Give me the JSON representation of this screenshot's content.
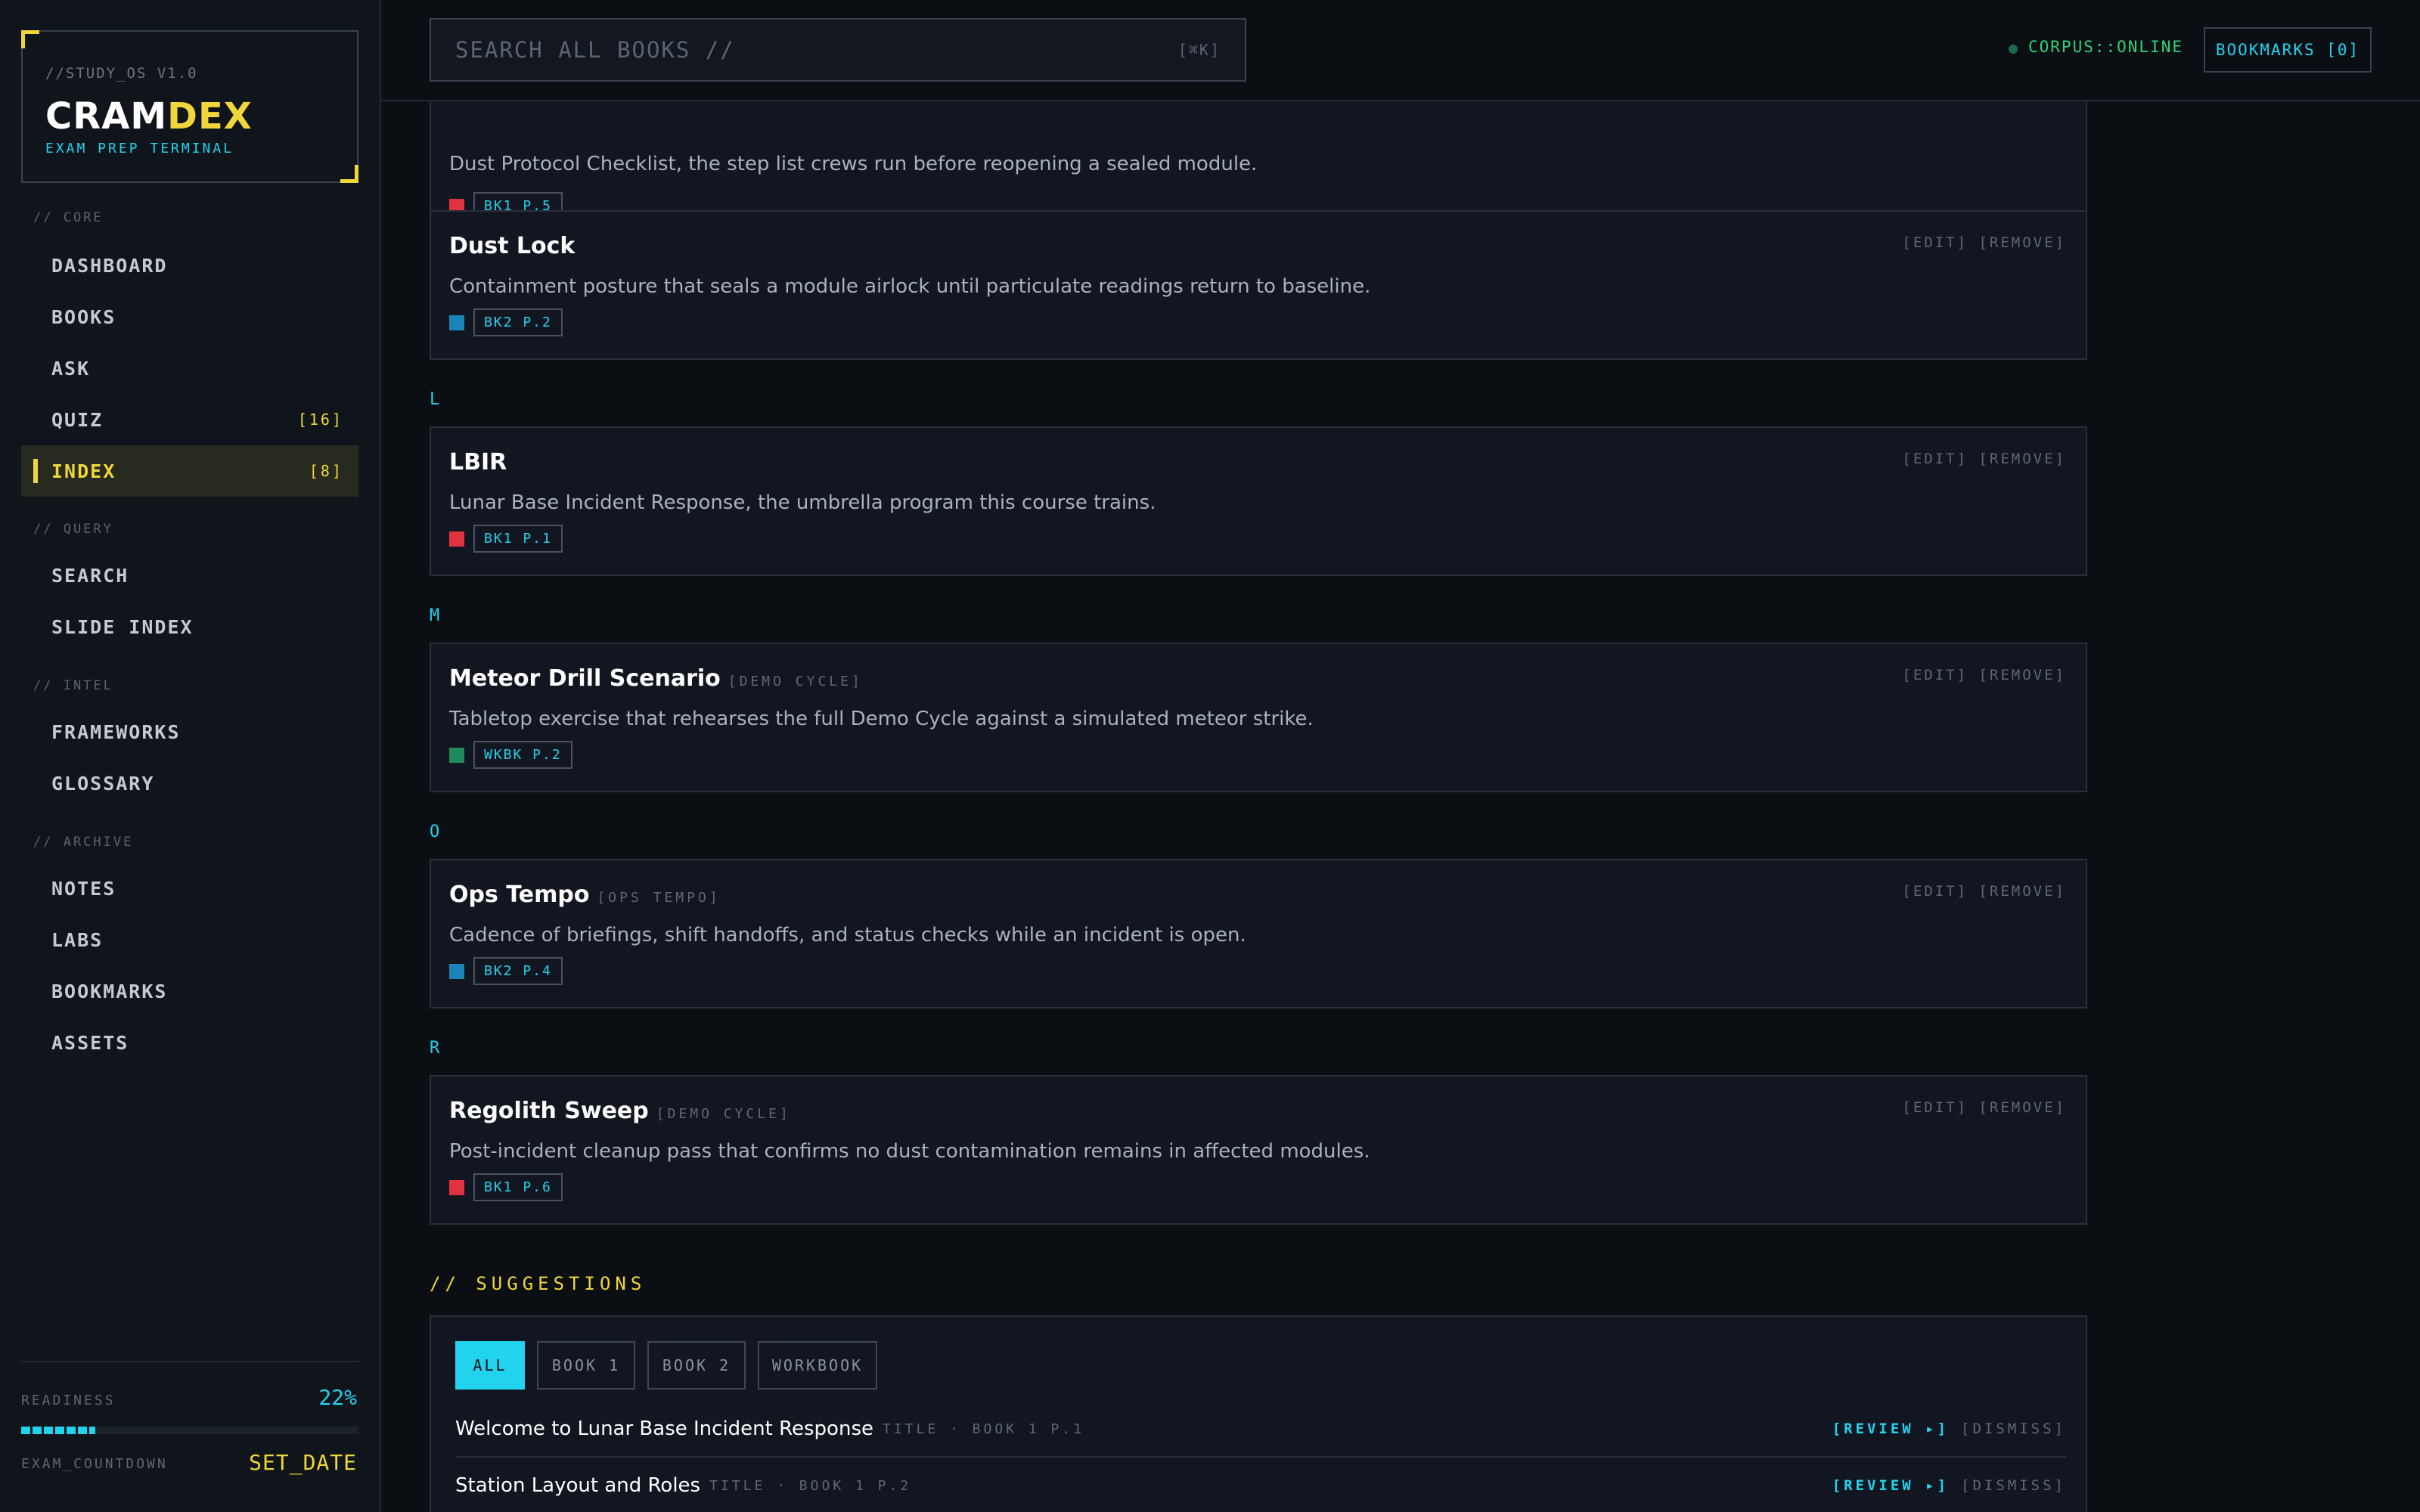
{
  "brand": {
    "version": "//STUDY_OS V1.0",
    "name_a": "CRAM",
    "name_b": "DEX",
    "tagline": "EXAM PREP TERMINAL"
  },
  "nav": {
    "core_label": "// CORE",
    "query_label": "// QUERY",
    "intel_label": "// INTEL",
    "archive_label": "// ARCHIVE",
    "items": [
      {
        "label": "DASHBOARD"
      },
      {
        "label": "BOOKS"
      },
      {
        "label": "ASK"
      },
      {
        "label": "QUIZ",
        "count": "[16]"
      },
      {
        "label": "INDEX",
        "count": "[8]"
      },
      {
        "label": "SEARCH"
      },
      {
        "label": "SLIDE INDEX"
      },
      {
        "label": "FRAMEWORKS"
      },
      {
        "label": "GLOSSARY"
      },
      {
        "label": "NOTES"
      },
      {
        "label": "LABS"
      },
      {
        "label": "BOOKMARKS"
      },
      {
        "label": "ASSETS"
      }
    ]
  },
  "footer": {
    "readiness_label": "READINESS",
    "readiness_value": "22%",
    "readiness_fraction": 0.22,
    "countdown_label": "EXAM_COUNTDOWN",
    "countdown_value": "SET_DATE"
  },
  "topbar": {
    "search_placeholder": "SEARCH ALL BOOKS //",
    "search_kbd": "[⌘K]",
    "status": "CORPUS::ONLINE",
    "bookmarks": "BOOKMARKS [0]"
  },
  "colors": {
    "book1": "#e0323f",
    "book2": "#1a85b8",
    "workbook": "#1f8a5c",
    "accent": "#22d3ee",
    "highlight": "#f0d63a"
  },
  "entries": [
    {
      "def": "Dust Protocol Checklist, the step list crews run before reopening a sealed module.",
      "ref": "BK1 P.5"
    },
    {
      "term": "Dust Lock",
      "def": "Containment posture that seals a module airlock until particulate readings return to baseline.",
      "ref": "BK2 P.2",
      "edit": "[EDIT]",
      "remove": "[REMOVE]"
    },
    {
      "letter": "L",
      "term": "LBIR",
      "def": "Lunar Base Incident Response, the umbrella program this course trains.",
      "ref": "BK1 P.1",
      "edit": "[EDIT]",
      "remove": "[REMOVE]"
    },
    {
      "letter": "M",
      "term": "Meteor Drill Scenario",
      "tag": "[DEMO CYCLE]",
      "def": "Tabletop exercise that rehearses the full Demo Cycle against a simulated meteor strike.",
      "ref": "WKBK P.2",
      "edit": "[EDIT]",
      "remove": "[REMOVE]"
    },
    {
      "letter": "O",
      "term": "Ops Tempo",
      "tag": "[OPS TEMPO]",
      "def": "Cadence of briefings, shift handoffs, and status checks while an incident is open.",
      "ref": "BK2 P.4",
      "edit": "[EDIT]",
      "remove": "[REMOVE]"
    },
    {
      "letter": "R",
      "term": "Regolith Sweep",
      "tag": "[DEMO CYCLE]",
      "def": "Post-incident cleanup pass that confirms no dust contamination remains in affected modules.",
      "ref": "BK1 P.6",
      "edit": "[EDIT]",
      "remove": "[REMOVE]"
    }
  ],
  "suggestions": {
    "title": "// SUGGESTIONS",
    "filters": [
      "ALL",
      "BOOK 1",
      "BOOK 2",
      "WORKBOOK"
    ],
    "rows": [
      {
        "title": "Welcome to Lunar Base Incident Response",
        "meta": "TITLE · BOOK 1 P.1",
        "review": "[REVIEW ▸]",
        "dismiss": "[DISMISS]"
      },
      {
        "title": "Station Layout and Roles",
        "meta": "TITLE · BOOK 1 P.2",
        "review": "[REVIEW ▸]",
        "dismiss": "[DISMISS]"
      }
    ]
  }
}
